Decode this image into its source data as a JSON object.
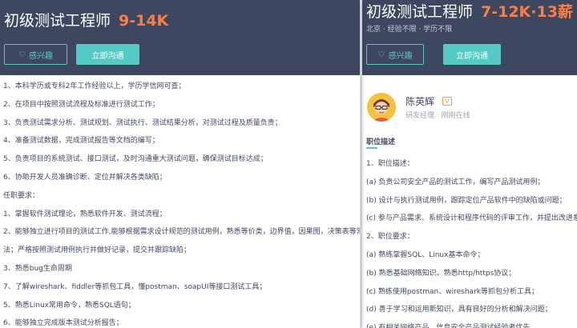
{
  "left": {
    "title": "初级测试工程师",
    "salary": "9-14K",
    "interest_label": "感兴趣",
    "chat_label": "立即沟通",
    "description": [
      "1、本科学历或专科2年工作经验以上，学历学信网可查；",
      "2、在项目中按照测试流程及标准进行测试工作；",
      "3、负责测试需求分析、测试规划、测试执行、测试结果分析，对测试过程及质量负责；",
      "4、准备测试数据，完成测试报告等文档的编写；",
      "5、负责项目的系统测试、接口测试，及时沟通重大测试问题，确保测试目标达成；",
      "6、协助开发人员准确诊断、定位并解决各类缺陷；",
      "任职要求：",
      "1、掌握软件测试理论，熟悉软件开发、测试流程；",
      "2、能够独立进行项目的测试工作,能够根据需求设计规范的测试用例，熟悉等价类，边界值，因果图，决策表等常见的黑盒测试方",
      "法；严格按照测试用例执行并做好记录，提交并跟踪缺陷；",
      "3、熟悉bug生命周期",
      "7、了解wireshark、fiddler等抓包工具，懂postman、soapUI等接口测试工具；",
      "5、熟悉Linux常用命令，熟悉SQL语句；",
      "6、能够独立完成版本测试分析报告；"
    ]
  },
  "right": {
    "title": "初级测试工程师",
    "salary": "7-12K·13薪",
    "meta": "北京 · 经验不限 · 学历不限",
    "interest_label": "感兴趣",
    "chat_label": "立即沟通",
    "recruiter_name": "陈英辉",
    "verified_badge": "V",
    "recruiter_sub": "研发经理 · 刚刚在线",
    "section_title": "职位描述",
    "description": [
      "1、职位描述：",
      "(a) 负责公司安全产品的测试工作，编写产品测试用例；",
      "(b) 设计与执行测试用例，跟踪定位产品软件中的缺陷或问题；",
      "(c) 参与产品需求、系统设计和程序代码的评审工作，并提出改进意见；",
      "2、职位要求：",
      "(a) 熟练掌握SQL、Linux基本命令；",
      "(b) 熟悉基础网络知识。熟悉http/https协议；",
      "(c) 熟练使用postman、wireshark等抓包分析工具；",
      "(d) 善于学习和运用新知识，具有良好的分析和解决问题；",
      "(e) 有相关网络产品、信息安全产品测试经验者优先。"
    ]
  },
  "icons": {
    "interest": "heart-outline-icon",
    "avatar": "cartoon-avatar-icon"
  },
  "colors": {
    "header_bg": "#3e4760",
    "salary": "#fd7d46",
    "accent": "#53cac3"
  }
}
